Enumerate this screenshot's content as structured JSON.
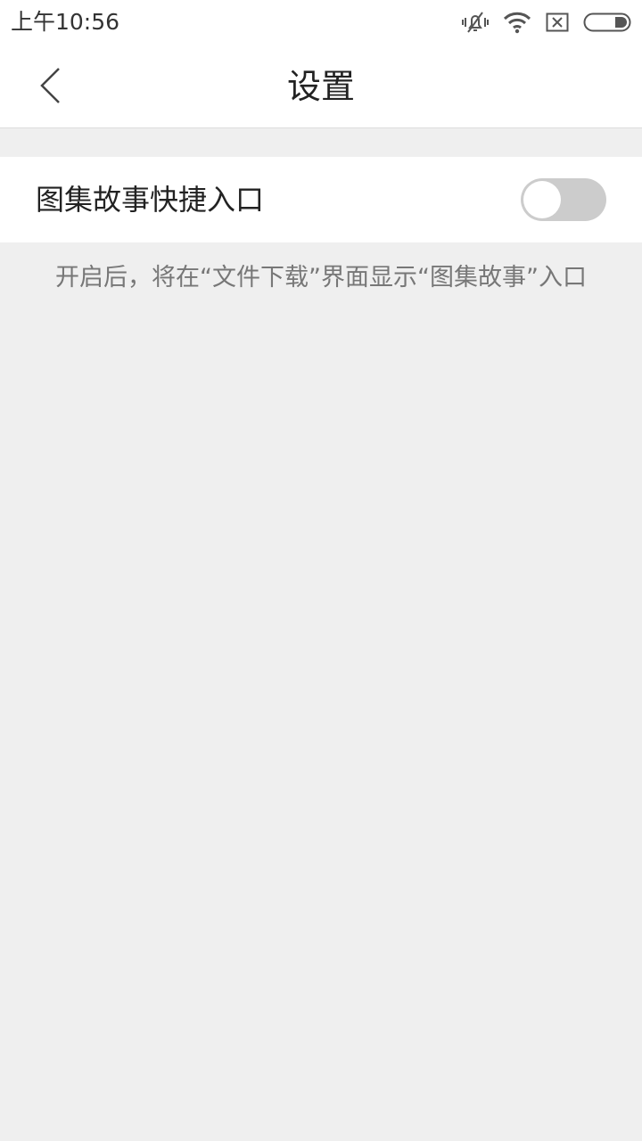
{
  "status_bar": {
    "time": "上午10:56",
    "icons": [
      "mute-vibrate-icon",
      "wifi-icon",
      "no-sim-icon",
      "battery-icon"
    ]
  },
  "header": {
    "title": "设置",
    "back_icon": "chevron-left-icon"
  },
  "settings": {
    "photo_story_shortcut": {
      "label": "图集故事快捷入口",
      "enabled": false,
      "hint": "开启后，将在“文件下载”界面显示“图集故事”入口"
    }
  },
  "colors": {
    "background": "#efefef",
    "surface": "#ffffff",
    "toggle_off": "#cccccc",
    "text_primary": "#222222",
    "text_secondary": "#777777"
  }
}
